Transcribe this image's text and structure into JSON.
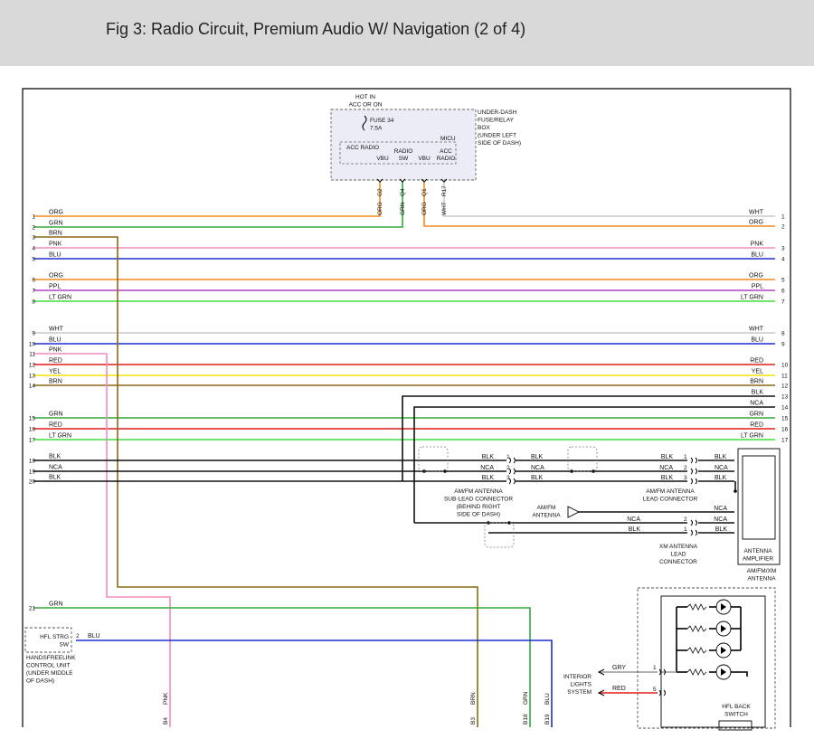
{
  "header": {
    "title": "Fig 3: Radio Circuit, Premium Audio W/ Navigation (2 of 4)"
  },
  "colors": {
    "ORG": "#f28a1e",
    "GRN": "#35a83a",
    "BRN": "#8b6914",
    "PNK": "#f08cc0",
    "BLU": "#1b2fd0",
    "PPL": "#b040c8",
    "LT GRN": "#3be03b",
    "WHT": "#c8c8c8",
    "RED": "#e01b1b",
    "YEL": "#f2e400",
    "BLK": "#111111",
    "NCA": "#444444",
    "GRY": "#999999"
  },
  "fuse_box": {
    "top_labels": [
      "HOT IN",
      "ACC OR ON"
    ],
    "fuse_labels": [
      "FUSE 34",
      "7.5A"
    ],
    "box_labels": [
      "UNDER-DASH",
      "FUSE/RELAY",
      "BOX",
      "(UNDER LEFT",
      "SIDE OF DASH)"
    ],
    "micu": "MICU",
    "acc_radio": "ACC RADIO",
    "radio": "RADIO",
    "acc": "ACC",
    "vbu1": "VBU",
    "sw": "SW",
    "vbu2": "VBU",
    "radio2": "RADIO",
    "pins": [
      "G2",
      "Q4",
      "Q1",
      "R17"
    ],
    "wires": [
      "ORG",
      "GRN",
      "ORG",
      "WHT"
    ]
  },
  "left_wires": [
    {
      "num": "1",
      "label": "ORG"
    },
    {
      "num": "2",
      "label": "GRN"
    },
    {
      "num": "3",
      "label": "BRN"
    },
    {
      "num": "4",
      "label": "PNK"
    },
    {
      "num": "5",
      "label": "BLU"
    },
    {
      "num": "6",
      "label": "ORG"
    },
    {
      "num": "7",
      "label": "PPL"
    },
    {
      "num": "8",
      "label": "LT GRN"
    },
    {
      "num": "9",
      "label": "WHT"
    },
    {
      "num": "10",
      "label": "BLU"
    },
    {
      "num": "11",
      "label": "PNK"
    },
    {
      "num": "12",
      "label": "RED"
    },
    {
      "num": "13",
      "label": "YEL"
    },
    {
      "num": "14",
      "label": "BRN"
    },
    {
      "num": "15",
      "label": "GRN"
    },
    {
      "num": "16",
      "label": "RED"
    },
    {
      "num": "17",
      "label": "LT GRN"
    },
    {
      "num": "18",
      "label": "BLK"
    },
    {
      "num": "19",
      "label": "NCA"
    },
    {
      "num": "20",
      "label": "BLK"
    },
    {
      "num": "21",
      "label": "GRN"
    }
  ],
  "right_wires": [
    {
      "num": "1",
      "label": "WHT"
    },
    {
      "num": "2",
      "label": "ORG"
    },
    {
      "num": "3",
      "label": "PNK"
    },
    {
      "num": "4",
      "label": "BLU"
    },
    {
      "num": "5",
      "label": "ORG"
    },
    {
      "num": "6",
      "label": "PPL"
    },
    {
      "num": "7",
      "label": "LT GRN"
    },
    {
      "num": "8",
      "label": "WHT"
    },
    {
      "num": "9",
      "label": "BLU"
    },
    {
      "num": "10",
      "label": "RED"
    },
    {
      "num": "11",
      "label": "YEL"
    },
    {
      "num": "12",
      "label": "BRN"
    },
    {
      "num": "13",
      "label": "BLK"
    },
    {
      "num": "14",
      "label": "NCA"
    },
    {
      "num": "15",
      "label": "GRN"
    },
    {
      "num": "16",
      "label": "RED"
    },
    {
      "num": "17",
      "label": "LT GRN"
    }
  ],
  "antenna": {
    "sub_lead": [
      "AM/FM ANTENNA",
      "SUB-LEAD CONNECTOR",
      "(BEHIND RIGHT",
      "SIDE OF DASH)"
    ],
    "lead": [
      "AM/FM ANTENNA",
      "LEAD CONNECTOR"
    ],
    "amfm": [
      "AM/FM",
      "ANTENNA"
    ],
    "xm_lead": [
      "XM ANTENNA",
      "LEAD",
      "CONNECTOR"
    ],
    "amplifier": [
      "ANTENNA",
      "AMPLIFIER"
    ],
    "amfm_xm": [
      "AM/FM/XM",
      "ANTENNA"
    ],
    "conn1_left": [
      "BLK",
      "NCA",
      "BLK"
    ],
    "conn1_right": [
      "BLK",
      "NCA",
      "BLK"
    ],
    "conn2_left": [
      "BLK",
      "NCA",
      "BLK"
    ],
    "conn2_right": [
      "BLK",
      "NCA",
      "BLK"
    ],
    "pins": [
      "1",
      "2",
      "3"
    ],
    "xm_pins": [
      "2",
      "1"
    ],
    "xm_left": [
      "NCA",
      "BLK"
    ],
    "xm_right": [
      "NCA",
      "BLK"
    ],
    "amfm_out": "NCA"
  },
  "hfl": {
    "switch": [
      "HFL STRG",
      "SW"
    ],
    "pin": "2",
    "wire": "BLU",
    "unit": [
      "HANDSFREELINK",
      "CONTROL UNIT",
      "(UNDER MIDDLE",
      "OF DASH)"
    ]
  },
  "interior": {
    "label": [
      "INTERIOR",
      "LIGHTS",
      "SYSTEM"
    ],
    "gry": "GRY",
    "red": "RED",
    "pin_gry": "1",
    "pin_red": "5",
    "back_switch": [
      "HFL BACK",
      "SWITCH"
    ]
  },
  "bottom_pins": [
    {
      "pin": "B4",
      "wire": "PNK"
    },
    {
      "pin": "B3",
      "wire": "BRN"
    },
    {
      "pin": "B18",
      "wire": "GRN"
    },
    {
      "pin": "B19",
      "wire": "BLU"
    }
  ]
}
